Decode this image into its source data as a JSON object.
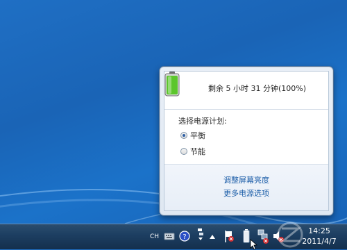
{
  "power_flyout": {
    "status_text": "剩余 5 小时 31 分钟(100%)",
    "plan_heading": "选择电源计划:",
    "plans": [
      {
        "label": "平衡",
        "selected": true
      },
      {
        "label": "节能",
        "selected": false
      }
    ],
    "links": [
      {
        "label": "调整屏幕亮度"
      },
      {
        "label": "更多电源选项"
      }
    ]
  },
  "taskbar": {
    "language": "CH",
    "tray_icons": [
      "keyboard-icon",
      "help-icon",
      "network-arrows-icon",
      "show-hidden-icons-arrow",
      "action-center-flag-icon",
      "battery-icon",
      "network-icon",
      "volume-muted-icon"
    ],
    "time": "14:25",
    "date": "2011/4/7"
  },
  "colors": {
    "desktop": "#1a64b6",
    "taskbar": "#1d3f62",
    "link": "#1c5ea8",
    "battery_green": "#5cc62c"
  }
}
